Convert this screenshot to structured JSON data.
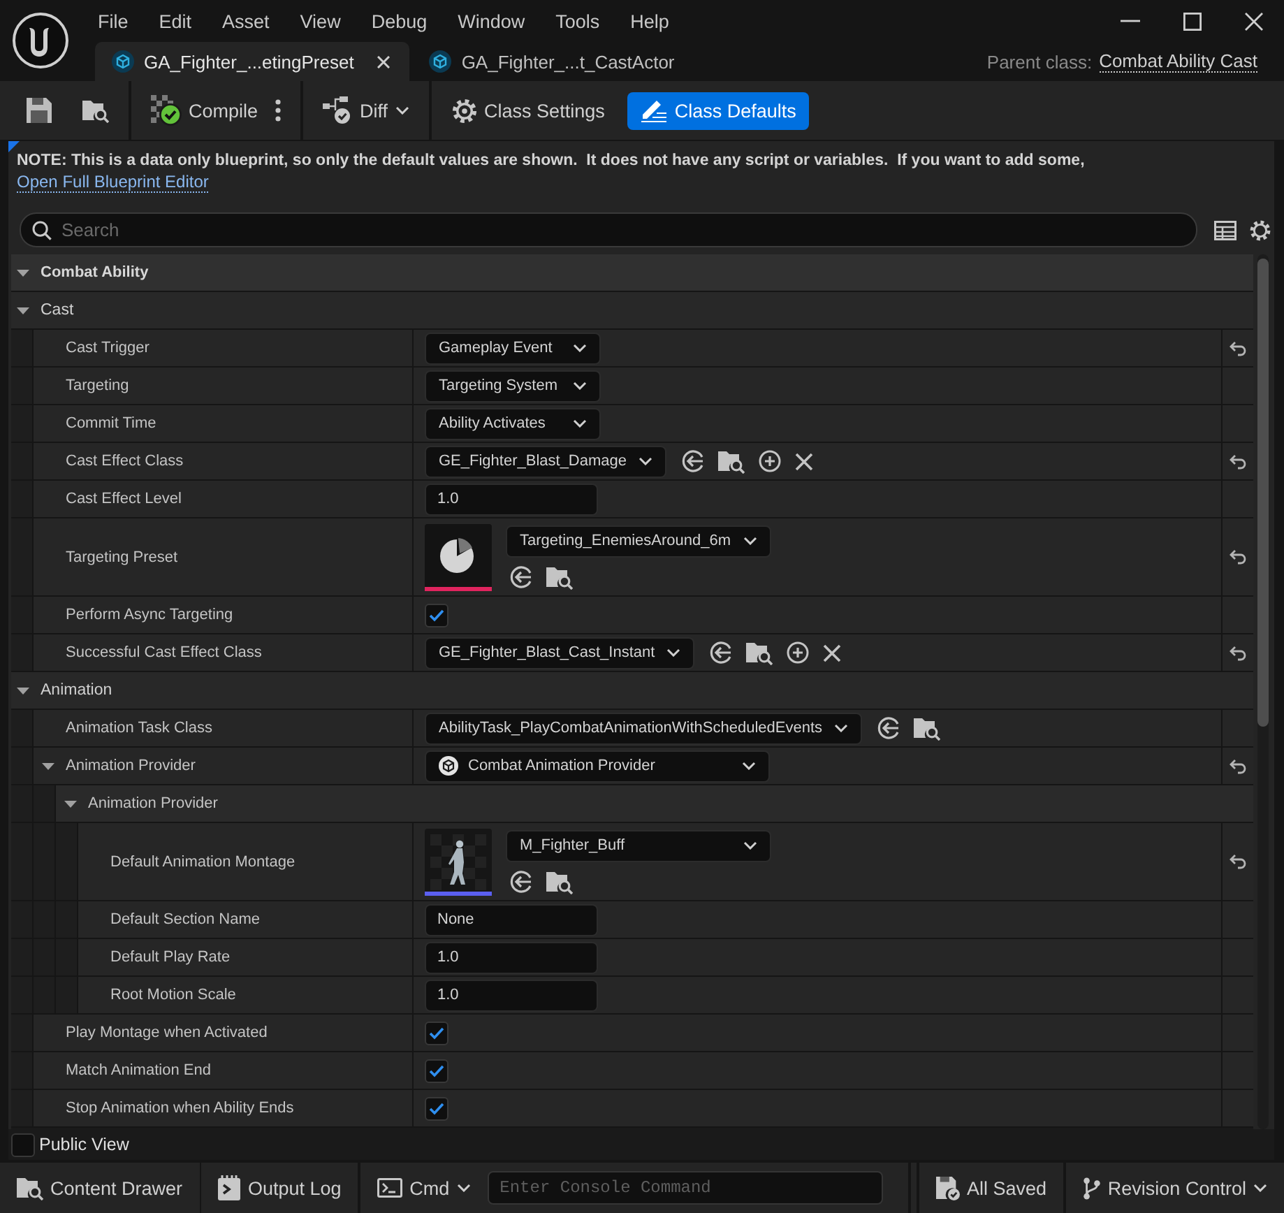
{
  "title_bar": {
    "menu": [
      "File",
      "Edit",
      "Asset",
      "View",
      "Debug",
      "Window",
      "Tools",
      "Help"
    ],
    "tabs": [
      {
        "label": "GA_Fighter_...etingPreset",
        "selected": true
      },
      {
        "label": "GA_Fighter_...t_CastActor",
        "selected": false
      }
    ],
    "parent_class": {
      "label": "Parent class:",
      "value": "Combat Ability Cast"
    }
  },
  "toolbar": {
    "compile": "Compile",
    "diff": "Diff",
    "modes": [
      {
        "label": "Class Settings",
        "selected": false
      },
      {
        "label": "Class Defaults",
        "selected": true
      }
    ]
  },
  "details": {
    "note": "NOTE: This is a data only blueprint, so only the default values are shown.  It does not have any script or variables.  If you want to add some,",
    "note_link": "Open Full Blueprint Editor",
    "search": {
      "placeholder": "Search"
    },
    "tree": [
      {
        "kind": "header",
        "label": "Combat Ability",
        "expanded": true,
        "children": [
          {
            "kind": "category",
            "label": "Cast",
            "expanded": true,
            "children": [
              {
                "kind": "dropdown",
                "label": "Cast Trigger",
                "value": "Gameplay Event",
                "reset": true
              },
              {
                "kind": "dropdown",
                "label": "Targeting",
                "value": "Targeting System",
                "reset": false
              },
              {
                "kind": "dropdown",
                "label": "Commit Time",
                "value": "Ability Activates",
                "reset": false
              },
              {
                "kind": "class",
                "label": "Cast Effect Class",
                "value": "GE_Fighter_Blast_Damage",
                "clearable": true,
                "reset": true
              },
              {
                "kind": "number",
                "label": "Cast Effect Level",
                "value": "1.0",
                "reset": false
              },
              {
                "kind": "preset",
                "label": "Targeting Preset",
                "value": "Targeting_EnemiesAround_6m",
                "reset": true
              },
              {
                "kind": "checkbox",
                "label": "Perform Async Targeting",
                "checked": true,
                "reset": false
              },
              {
                "kind": "class",
                "label": "Successful Cast Effect Class",
                "value": "GE_Fighter_Blast_Cast_Instant",
                "clearable": true,
                "reset": true
              }
            ]
          },
          {
            "kind": "category",
            "label": "Animation",
            "expanded": true,
            "children": [
              {
                "kind": "class",
                "label": "Animation Task Class",
                "value": "AbilityTask_PlayCombatAnimationWithScheduledEvents",
                "clearable": false,
                "reset": false
              },
              {
                "kind": "struct",
                "label": "Animation Provider",
                "value": "Combat Animation Provider",
                "expanded": true,
                "reset": true,
                "children": [
                  {
                    "kind": "group",
                    "label": "Animation Provider",
                    "expanded": true,
                    "children": [
                      {
                        "kind": "montage",
                        "label": "Default Animation Montage",
                        "value": "M_Fighter_Buff",
                        "reset": true
                      },
                      {
                        "kind": "text",
                        "label": "Default Section Name",
                        "value": "None",
                        "reset": false
                      },
                      {
                        "kind": "number",
                        "label": "Default Play Rate",
                        "value": "1.0",
                        "reset": false
                      },
                      {
                        "kind": "number",
                        "label": "Root Motion Scale",
                        "value": "1.0",
                        "reset": false
                      }
                    ]
                  }
                ]
              },
              {
                "kind": "checkbox",
                "label": "Play Montage when Activated",
                "checked": true,
                "reset": false
              },
              {
                "kind": "checkbox",
                "label": "Match Animation End",
                "checked": true,
                "reset": false
              },
              {
                "kind": "checkbox",
                "label": "Stop Animation when Ability Ends",
                "checked": true,
                "reset": false
              }
            ]
          }
        ]
      }
    ],
    "public_view": {
      "label": "Public View",
      "checked": false
    }
  },
  "status_bar": {
    "content_drawer": "Content Drawer",
    "output_log": "Output Log",
    "cmd": "Cmd",
    "console": {
      "placeholder": "Enter Console Command"
    },
    "save_state": "All Saved",
    "revision_control": "Revision Control"
  }
}
